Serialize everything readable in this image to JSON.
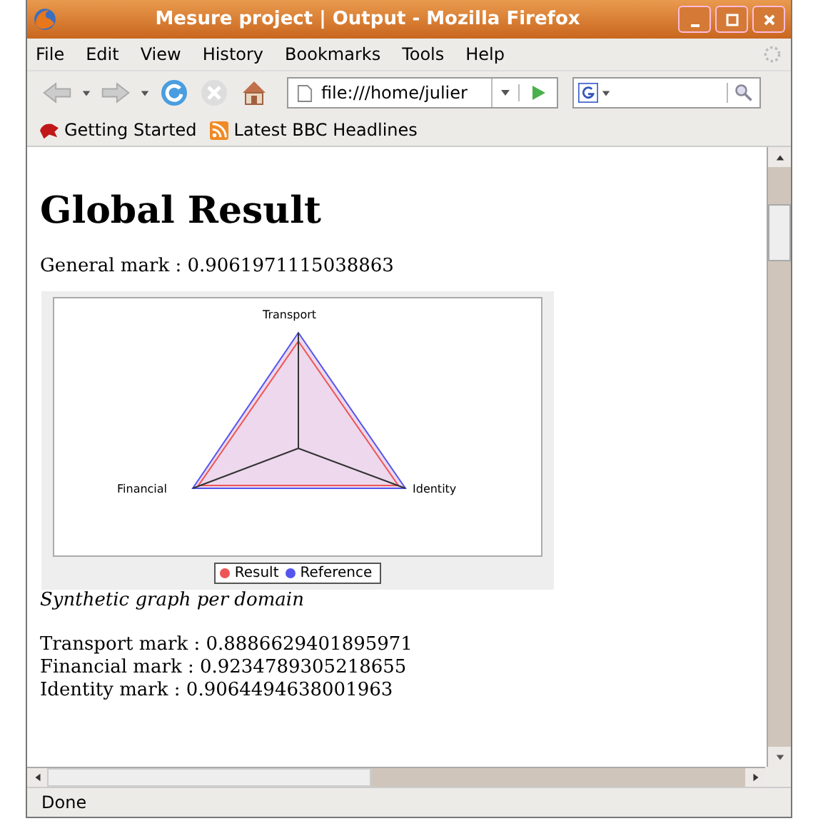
{
  "window": {
    "title": "Mesure project | Output - Mozilla Firefox"
  },
  "menu": [
    "File",
    "Edit",
    "View",
    "History",
    "Bookmarks",
    "Tools",
    "Help"
  ],
  "address": {
    "value": "file:///home/julier"
  },
  "bookmarks": [
    "Getting Started",
    "Latest BBC Headlines"
  ],
  "page": {
    "heading": "Global Result",
    "general": "General mark : 0.9061971115038863",
    "chart": {
      "axes": [
        "Transport",
        "Identity",
        "Financial"
      ],
      "legend": [
        {
          "label": "Result",
          "color": "#ee5555"
        },
        {
          "label": "Reference",
          "color": "#5555ee"
        }
      ]
    },
    "caption": "Synthetic graph per domain",
    "marks": [
      "Transport mark : 0.8886629401895971",
      "Financial mark : 0.9234789305218655",
      "Identity mark : 0.9064494638001963"
    ]
  },
  "status_bar": "Done"
}
